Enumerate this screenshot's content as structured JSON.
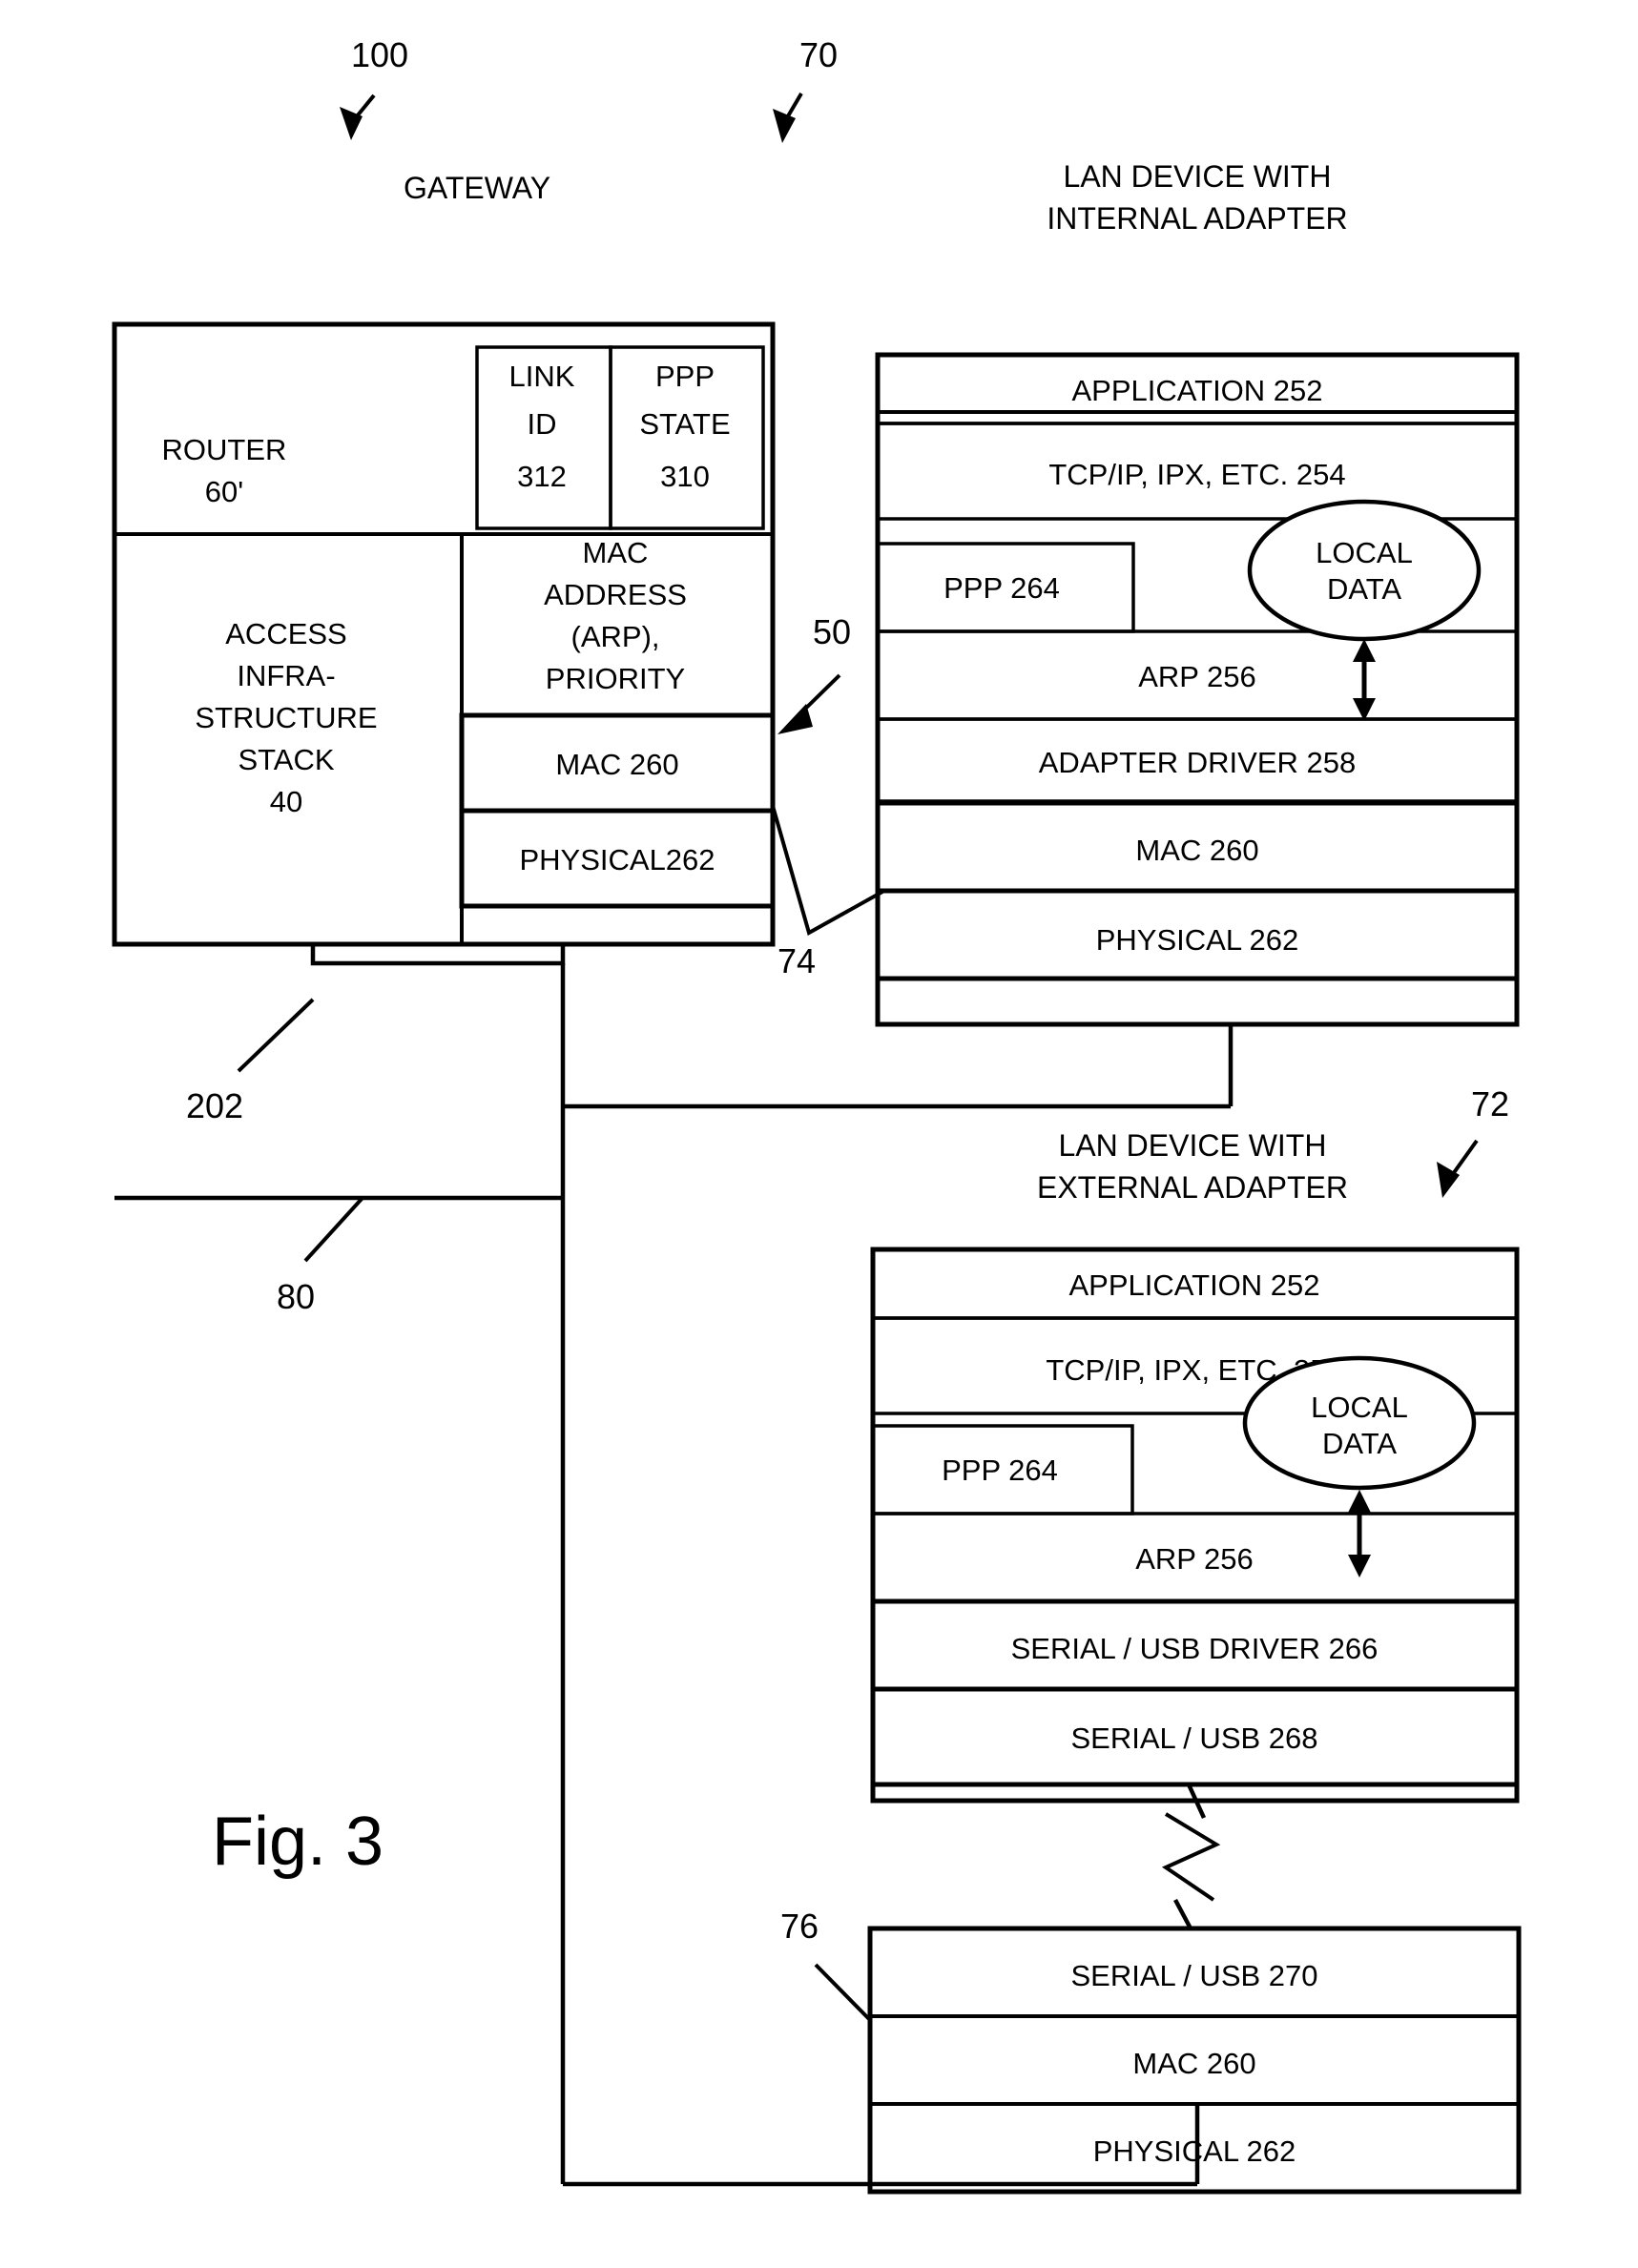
{
  "figure": {
    "label": "Fig. 3",
    "reference_numerals": {
      "system": "100",
      "lan_device_internal": "70",
      "lan_device_external": "72",
      "gateway_stack_link": "50",
      "internal_adapter_link": "74",
      "external_adapter_link": "76",
      "gateway_bus": "202",
      "lan_bus": "80"
    }
  },
  "gateway": {
    "title": "GATEWAY",
    "router": {
      "line1": "ROUTER",
      "line2": "60'"
    },
    "link_id": {
      "line1": "LINK",
      "line2": "ID",
      "line3": "312"
    },
    "ppp_state": {
      "line1": "PPP",
      "line2": "STATE",
      "line3": "310"
    },
    "access_stack": {
      "line1": "ACCESS",
      "line2": "INFRA-",
      "line3": "STRUCTURE",
      "line4": "STACK",
      "line5": "40"
    },
    "mac_address": {
      "line1": "MAC",
      "line2": "ADDRESS",
      "line3": "(ARP),",
      "line4": "PRIORITY"
    },
    "mac_layer": "MAC 260",
    "physical_layer": "PHYSICAL262"
  },
  "lan_device_internal": {
    "title_line1": "LAN DEVICE WITH",
    "title_line2": "INTERNAL ADAPTER",
    "layers": [
      "APPLICATION 252",
      "TCP/IP, IPX, ETC. 254",
      "ARP 256",
      "ADAPTER DRIVER 258",
      "MAC 260",
      "PHYSICAL 262"
    ],
    "ppp_box": "PPP 264",
    "local_data": {
      "line1": "LOCAL",
      "line2": "DATA"
    }
  },
  "lan_device_external": {
    "title_line1": "LAN DEVICE WITH",
    "title_line2": "EXTERNAL ADAPTER",
    "layers": [
      "APPLICATION 252",
      "TCP/IP, IPX, ETC. 254",
      "ARP 256",
      "SERIAL / USB DRIVER 266",
      "SERIAL / USB 268"
    ],
    "ppp_box": "PPP 264",
    "local_data": {
      "line1": "LOCAL",
      "line2": "DATA"
    },
    "adapter_layers": [
      "SERIAL / USB 270",
      "MAC 260",
      "PHYSICAL 262"
    ]
  }
}
